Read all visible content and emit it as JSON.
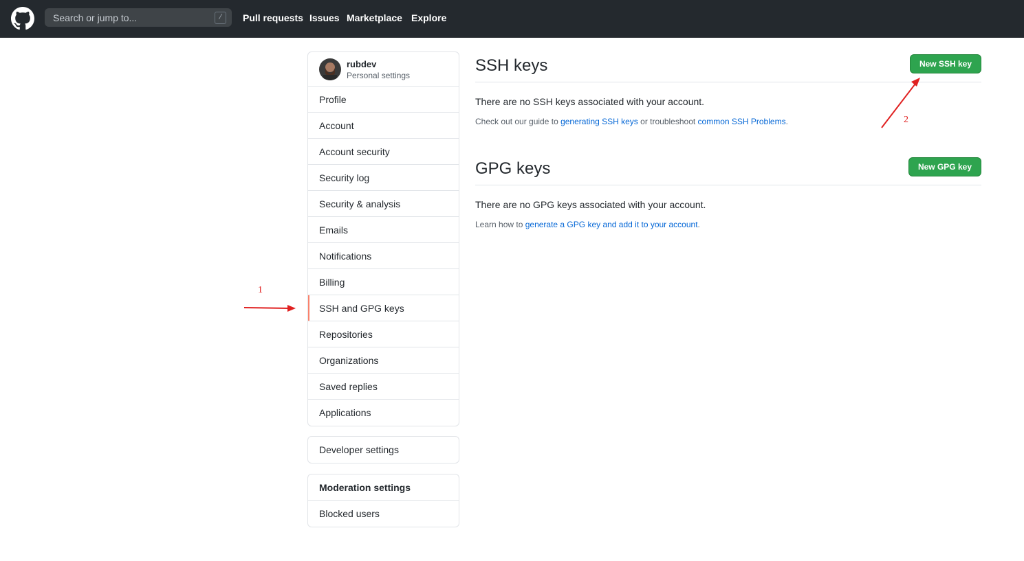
{
  "header": {
    "search_placeholder": "Search or jump to...",
    "search_shortcut": "/",
    "nav": [
      "Pull requests",
      "Issues",
      "Marketplace",
      "Explore"
    ]
  },
  "sidebar": {
    "user": {
      "name": "rubdev",
      "subtitle": "Personal settings"
    },
    "items": [
      "Profile",
      "Account",
      "Account security",
      "Security log",
      "Security & analysis",
      "Emails",
      "Notifications",
      "Billing",
      "SSH and GPG keys",
      "Repositories",
      "Organizations",
      "Saved replies",
      "Applications"
    ],
    "active_item": "SSH and GPG keys",
    "developer": "Developer settings",
    "moderation": {
      "title": "Moderation settings",
      "items": [
        "Blocked users"
      ]
    }
  },
  "ssh": {
    "title": "SSH keys",
    "button": "New SSH key",
    "empty": "There are no SSH keys associated with your account.",
    "guide_prefix": "Check out our guide to ",
    "guide_link1": "generating SSH keys",
    "guide_mid": " or troubleshoot ",
    "guide_link2": "common SSH Problems",
    "guide_suffix": "."
  },
  "gpg": {
    "title": "GPG keys",
    "button": "New GPG key",
    "empty": "There are no GPG keys associated with your account.",
    "learn_prefix": "Learn how to ",
    "learn_link": "generate a GPG key and add it to your account",
    "learn_suffix": "."
  },
  "annotations": {
    "label1": "1",
    "label2": "2",
    "color": "#e02020"
  },
  "colors": {
    "header_bg": "#24292e",
    "button_green": "#2ea44f",
    "link": "#0366d6",
    "active_marker": "#f9826c"
  }
}
